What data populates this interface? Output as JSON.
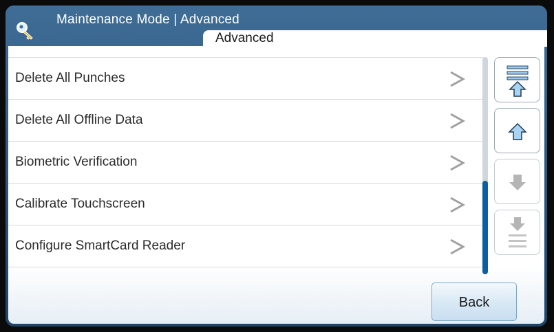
{
  "header": {
    "title": "Maintenance Mode | Advanced",
    "tab_label": "Advanced"
  },
  "menu": {
    "items": [
      {
        "label": "Delete All Punches"
      },
      {
        "label": "Delete All Offline Data"
      },
      {
        "label": "Biometric Verification"
      },
      {
        "label": "Calibrate Touchscreen"
      },
      {
        "label": "Configure SmartCard Reader"
      }
    ]
  },
  "scroll": {
    "position_fraction": 1.0,
    "visible_fraction": 0.43
  },
  "nav": {
    "buttons": [
      {
        "name": "scroll-top",
        "icon": "scroll-to-top-icon",
        "enabled": true
      },
      {
        "name": "scroll-up",
        "icon": "arrow-up-icon",
        "enabled": true
      },
      {
        "name": "scroll-down",
        "icon": "arrow-down-icon",
        "enabled": false
      },
      {
        "name": "scroll-bottom",
        "icon": "scroll-to-bottom-icon",
        "enabled": false
      }
    ]
  },
  "footer": {
    "back_label": "Back"
  },
  "colors": {
    "header_blue": "#2f5a80",
    "scroll_thumb": "#0b5ea3",
    "arrow_enabled": "#a9d3f2",
    "arrow_disabled": "#b5b5b5"
  }
}
